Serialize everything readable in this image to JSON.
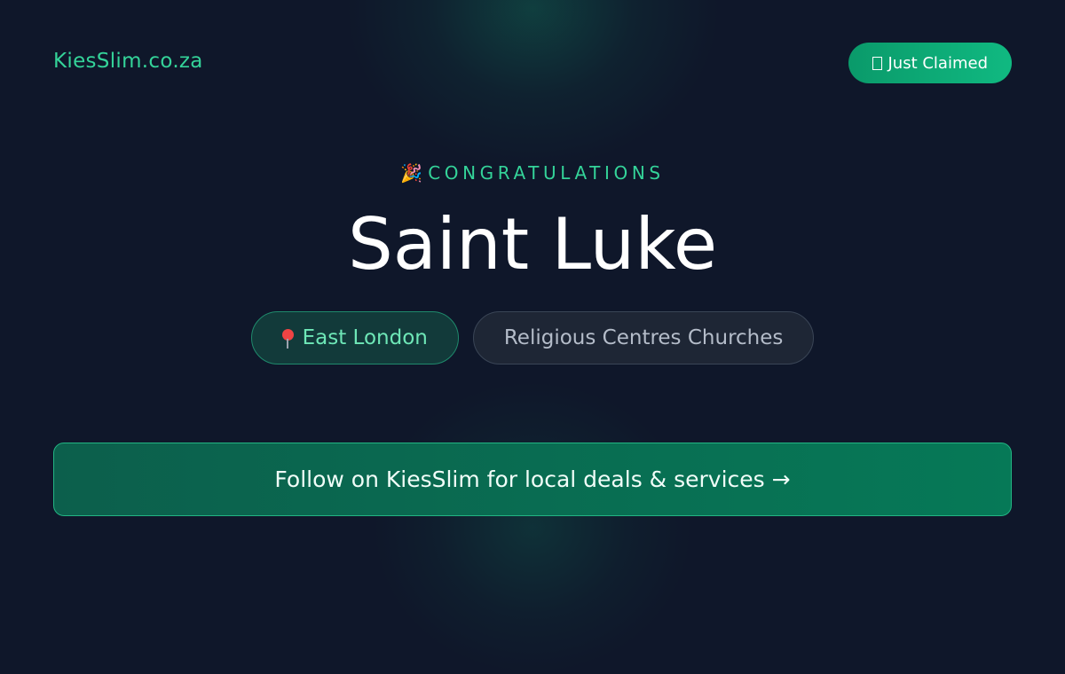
{
  "brand": {
    "name": "KiesSlim.co.za"
  },
  "badge": {
    "icon": "hourglass-icon",
    "label": "Just Claimed"
  },
  "hero": {
    "eyebrow": "CONGRATULATIONS",
    "eyebrow_icon": "party-popper-icon",
    "title": "Saint Luke"
  },
  "tags": {
    "location": {
      "icon": "map-pin-icon",
      "label": "East London"
    },
    "category": {
      "label": "Religious Centres Churches"
    }
  },
  "cta": {
    "label": "Follow on KiesSlim for local deals & services →"
  },
  "colors": {
    "background": "#0f172a",
    "accent": "#34d399",
    "badge": "#10b981",
    "cta": "#067957"
  }
}
